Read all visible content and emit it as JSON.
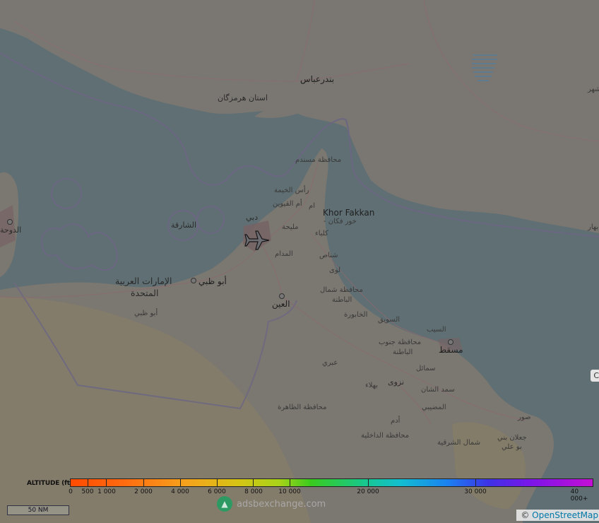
{
  "map": {
    "labels": {
      "bandar_abbas": "بندرعباس",
      "hormozgan": "استان هرمزگان",
      "musandam": "محافظة مسندم",
      "ras_al_khaimah": "رأس الخيمة",
      "umm_al_quwain": "أم القيوين",
      "khor_fakkan_en": "Khor Fakkan",
      "khor_fakkan_ar": "- خور فكان",
      "dubai": "دبي",
      "sharjah_sea": "الشارقة",
      "mleiha": "مليحة",
      "kalba": "كلباء",
      "madam": "المدام",
      "shinas": "شناص",
      "doha": "الدوحة",
      "uae_line1": "الإمارات العربية",
      "uae_line2": "المتحدة",
      "abu_dhabi_city": "أبو ظبي",
      "abu_dhabi_region": "أبو ظبي",
      "liwa": "لوى",
      "north_batinah_1": "محافظة شمال",
      "north_batinah_2": "الباطنة",
      "al_ain": "العين",
      "khaburah": "الخابورة",
      "suwaiq": "السويق",
      "seeb": "السيب",
      "south_batinah_1": "محافظة جنوب",
      "south_batinah_2": "الباطنة",
      "muscat": "مسقط",
      "ibri": "عبري",
      "samail": "سمائل",
      "nizwa": "نزوى",
      "bahla": "بهلاء",
      "sumad_shan": "سمد الشان",
      "dhahirah": "محافظة الظاهرة",
      "mudaybi": "المضيبي",
      "adam": "أدم",
      "sur": "صور",
      "dakhiliyah": "محافظة الداخلية",
      "north_sharqiyah": "شمال الشرقية",
      "jalan_1": "جعلان بني",
      "jalan_2": "بو علي",
      "top_right": "شهر",
      "right_edge": "بهار",
      "om": "ام"
    }
  },
  "legend": {
    "title": "ALTITUDE (ft)",
    "ticks": [
      "0",
      "500",
      "1 000",
      "2 000",
      "4 000",
      "6 000",
      "8 000",
      "10 000",
      "20 000",
      "30 000",
      "40 000+"
    ]
  },
  "scale_bar": {
    "label": "50 NM"
  },
  "branding": {
    "text": "adsbexchange.com"
  },
  "attribution": {
    "prefix": "©",
    "link": "OpenStreetMap"
  },
  "edge_button": {
    "label": "C"
  },
  "colors": {
    "sea": "#5f6f73",
    "land": "#7b7771",
    "desert": "#877c68",
    "border": "#7a6e86",
    "road": "#8f6a6f"
  }
}
